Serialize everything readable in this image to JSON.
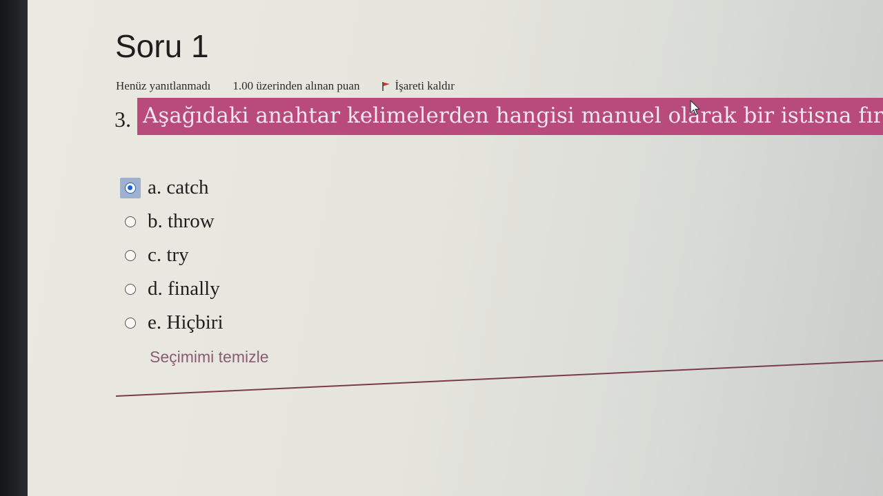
{
  "question": {
    "title": "Soru 1",
    "state": "Henüz yanıtlanmadı",
    "grade": "1.00 üzerinden alınan puan",
    "flag_label": "İşareti kaldır",
    "number": "3.",
    "text": "Aşağıdaki anahtar kelimelerden hangisi manuel olarak bir istisna fırlatır"
  },
  "answers": {
    "options": [
      {
        "label": "a. catch",
        "checked": true
      },
      {
        "label": "b. throw",
        "checked": false
      },
      {
        "label": "c. try",
        "checked": false
      },
      {
        "label": "d. finally",
        "checked": false
      },
      {
        "label": "e. Hiçbiri",
        "checked": false
      }
    ],
    "clear_label": "Seçimimi temizle"
  },
  "colors": {
    "highlight": "#b84a7c",
    "flag": "#c0392b",
    "radio_selected": "#1f5fd0",
    "link": "#8c5a72",
    "divider": "#7b3a4a"
  },
  "icons": {
    "flag": "flag-icon",
    "cursor": "mouse-pointer-icon"
  }
}
